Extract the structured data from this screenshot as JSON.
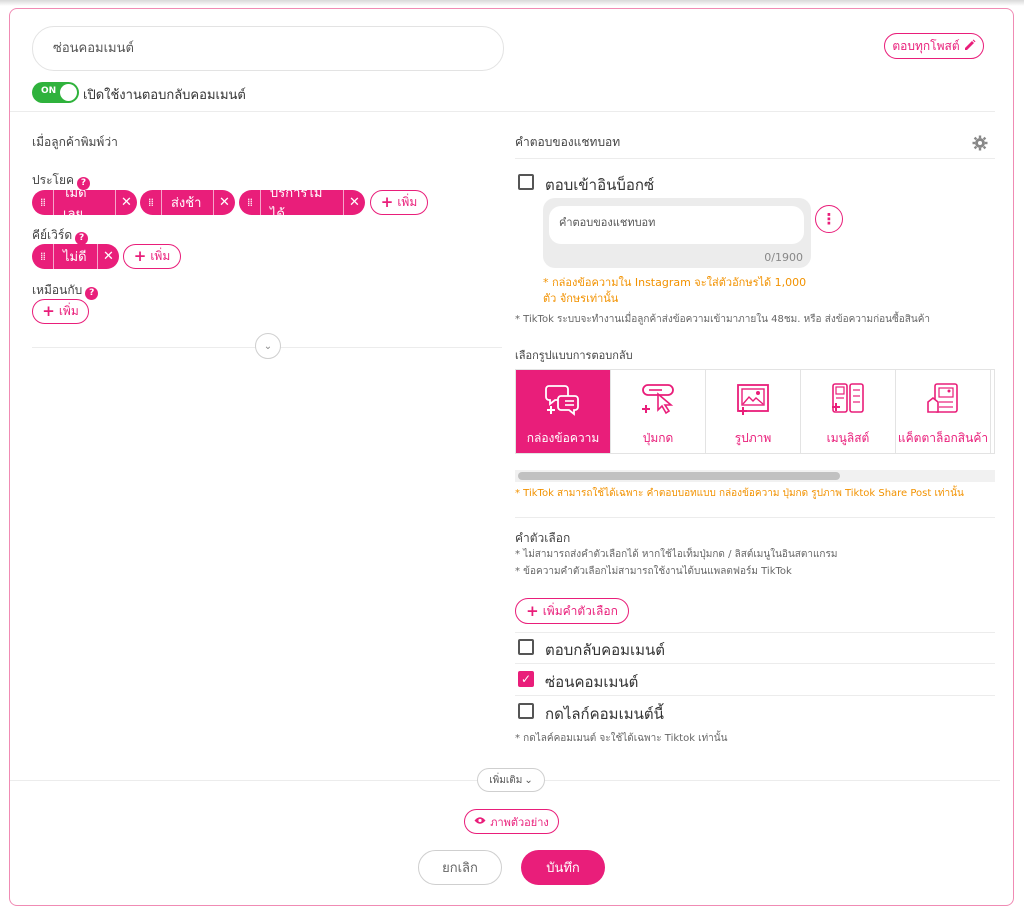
{
  "form": {
    "name_value": "ซ่อนคอมเมนต์",
    "reply_all_posts": "ตอบทุกโพสต์",
    "toggle_state": "ON",
    "toggle_label": "เปิดใช้งานตอบกลับคอมเมนต์"
  },
  "left": {
    "section_title": "เมื่อลูกค้าพิมพ์ว่า",
    "sentence_label": "ประโยค",
    "sentence_tags": [
      "ไม่ดีเลย",
      "ส่งช้า",
      "บริการไม่ได้"
    ],
    "keyword_label": "คีย์เวิร์ด",
    "keyword_tags": [
      "ไม่ดี"
    ],
    "similar_label": "เหมือนกับ",
    "add_label": "เพิ่ม"
  },
  "right": {
    "section_title": "คำตอบของแชทบอท",
    "inbox_label": "ตอบเข้าอินบ็อกซ์",
    "reply_placeholder": "คำตอบของแชทบอท",
    "counter": "0/1900",
    "instagram_note": "* กล่องข้อความใน Instagram จะใส่ตัวอักษรได้ 1,000 ตัว จักษรเท่านั้น",
    "tiktok_note": "* TikTok ระบบจะทำงานเมื่อลูกค้าส่งข้อความเข้ามาภายใน 48ชม. หรือ ส่งข้อความก่อนซื้อสินค้า",
    "choose_type_label": "เลือกรูปแบบการตอบกลับ",
    "types": [
      {
        "label": "กล่องข้อความ",
        "icon": "chat-bubbles-icon"
      },
      {
        "label": "ปุ่มกด",
        "icon": "button-cursor-icon"
      },
      {
        "label": "รูปภาพ",
        "icon": "image-icon"
      },
      {
        "label": "เมนูลิสต์",
        "icon": "menu-list-icon"
      },
      {
        "label": "แค็ตตาล็อกสินค้า",
        "icon": "catalog-icon"
      }
    ],
    "tiktok_types_note": "* TikTok สามารถใช้ได้เฉพาะ คำตอบบอทแบบ กล่องข้อความ ปุ่มกด รูปภาพ Tiktok Share Post เท่านั้น",
    "options_title": "คำตัวเลือก",
    "options_note_1": "* ไม่สามารถส่งคำตัวเลือกได้ หากใช้ไอเท็มปุ่มกด / ลิสต์เมนูในอินสตาแกรม",
    "options_note_2": "* ข้อความคำตัวเลือกไม่สามารถใช้งานได้บนแพลตฟอร์ม TikTok",
    "add_option_label": "เพิ่มคำตัวเลือก",
    "checkboxes": [
      {
        "label": "ตอบกลับคอมเมนต์",
        "checked": false
      },
      {
        "label": "ซ่อนคอมเมนต์",
        "checked": true
      },
      {
        "label": "กดไลก์คอมเมนต์นี้",
        "checked": false
      }
    ],
    "like_note": "* กดไลค์คอมเมนต์ จะใช้ได้เฉพาะ Tiktok เท่านั้น"
  },
  "footer": {
    "more_label": "เพิ่มเติม",
    "preview_label": "ภาพตัวอย่าง",
    "cancel_label": "ยกเลิก",
    "save_label": "บันทึก"
  },
  "colors": {
    "accent": "#e91e7a",
    "toggle_on": "#2fb23c",
    "warning": "#f29200"
  }
}
